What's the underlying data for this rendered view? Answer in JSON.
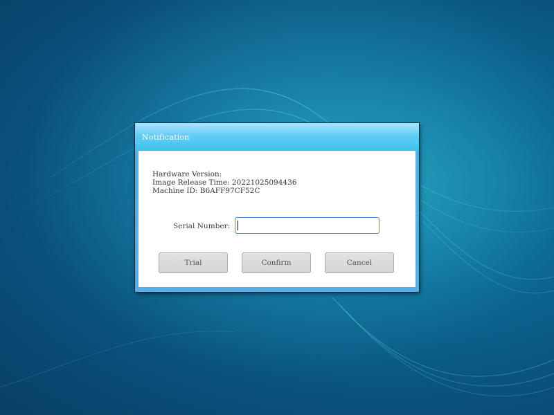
{
  "dialog": {
    "title": "Notification",
    "info_lines": {
      "hardware_version": "Hardware Version:",
      "image_release_time": "Image Release Time: 20221025094436",
      "machine_id": "Machine ID: B6AFF97CF52C"
    },
    "serial": {
      "label": "Serial Number:",
      "value": ""
    },
    "buttons": {
      "trial": "Trial",
      "confirm": "Confirm",
      "cancel": "Cancel"
    }
  },
  "colors": {
    "titlebar": "#3ec3f0",
    "input_border": "#3d8ee6",
    "desktop": "#0a4f7a"
  }
}
